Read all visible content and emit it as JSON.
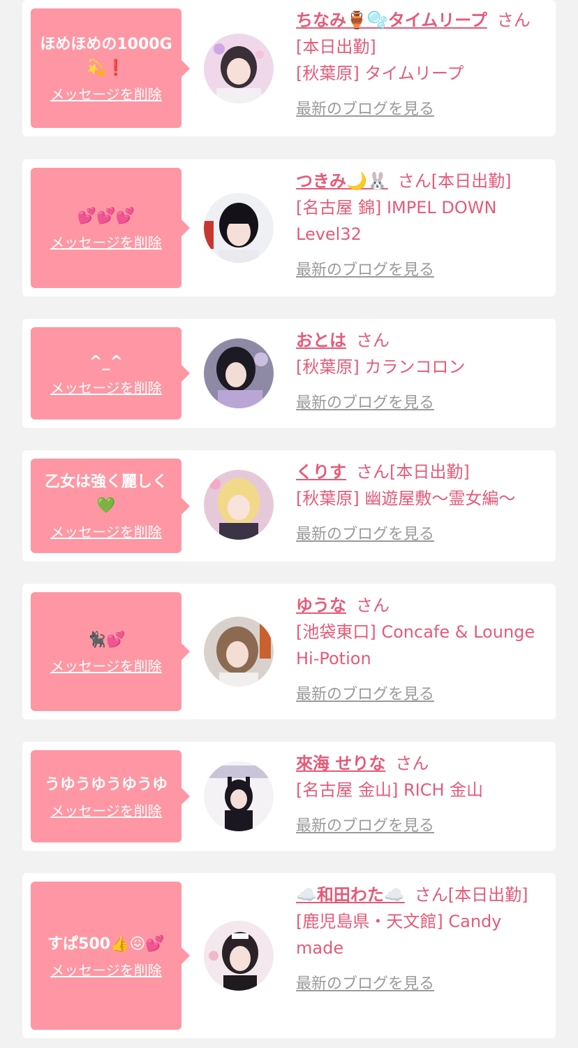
{
  "delete_label": "メッセージを削除",
  "blog_label": "最新のブログを見る",
  "san_label": "さん",
  "colors": {
    "bubble": "#fe97a3",
    "link": "#e65a78",
    "blog_link": "#9a9a9a",
    "page_bg": "#f2f2f2"
  },
  "entries": [
    {
      "message": "ほめほめの1000G\n💫❗",
      "name": "ちなみ🏺🫧タイムリープ",
      "status": "[本日出勤]",
      "shop": "[秋葉原] タイムリープ"
    },
    {
      "message": "💕💕💕",
      "name": "つきみ🌙🐰",
      "status": "[本日出勤]",
      "shop": "[名古屋 錦] IMPEL DOWN Level32"
    },
    {
      "message": "^_^",
      "name": "おとは",
      "status": "",
      "shop": "[秋葉原] カランコロン"
    },
    {
      "message": "乙女は強く麗しく\n💚",
      "name": "くりす",
      "status": "[本日出勤]",
      "shop": "[秋葉原] 幽遊屋敷〜霊女編〜"
    },
    {
      "message": "🐈‍⬛💕",
      "name": "ゆうな",
      "status": "",
      "shop": "[池袋東口] Concafe & Lounge Hi-Potion"
    },
    {
      "message": "うゆうゆうゆうゆ",
      "name": "來海 せりな",
      "status": "",
      "shop": "[名古屋 金山] RICH 金山"
    },
    {
      "message": "すぱ500👍😖💕",
      "name": "☁️和田わた☁️",
      "status": "[本日出勤]",
      "shop": "[鹿児島県・天文館] Candy made"
    }
  ]
}
